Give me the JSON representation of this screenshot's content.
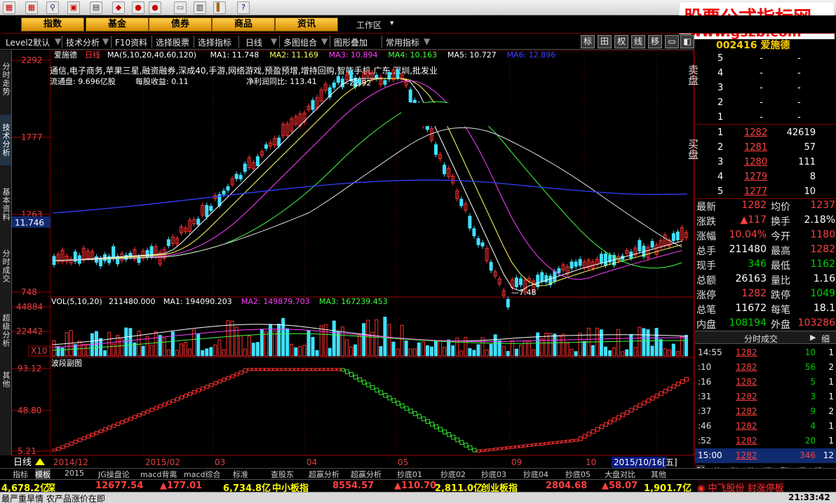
{
  "brand": {
    "line1": "股票公式指标网",
    "line2": "www.gszb.com"
  },
  "toolbar": {
    "icons": [
      "grid-icon",
      "grid-icon",
      "binoculars-icon",
      "box-icon",
      "doc-icon",
      "diamond-icon",
      "globe-icon",
      "globe-icon",
      "globe-icon",
      "doc-icon",
      "book-icon",
      "bars-icon",
      "help-icon"
    ]
  },
  "navbar": {
    "items": [
      "指数",
      "基金",
      "债券",
      "商品",
      "资讯"
    ],
    "workspace": "工作区"
  },
  "menu": {
    "items": [
      "Level2默认",
      "技术分析",
      "F10资料",
      "选择股票",
      "选择指标",
      "日线",
      "多图组合",
      "图形叠加",
      "常用指标"
    ],
    "toggles": [
      "标",
      "田",
      "权",
      "线",
      "移"
    ]
  },
  "left_tabs": [
    "分时走势",
    "技术分析",
    "基本资料",
    "分时成交",
    "超级分析",
    "其他"
  ],
  "chart": {
    "stock_name": "爱施德",
    "period": "日线",
    "ma_label": "MA(5,10,20,40,60,120)",
    "ma_values": [
      {
        "name": "MA1",
        "value": "11.748",
        "color": "#ffffff"
      },
      {
        "name": "MA2",
        "value": "11.169",
        "color": "#ffff60"
      },
      {
        "name": "MA3",
        "value": "10.894",
        "color": "#ff40ff"
      },
      {
        "name": "MA4",
        "value": "10.163",
        "color": "#40ff40"
      },
      {
        "name": "MA5",
        "value": "10.727",
        "color": "#ffffff"
      },
      {
        "name": "MA6",
        "value": "12.896",
        "color": "#4040ff"
      }
    ],
    "concepts": "通信,电子商务,苹果三星,融资融券,深成40,手游,网络游戏,预盈预增,增持回购,智能手机,广东,深圳,批发业",
    "float_shares": "流通盘: 9.696亿股",
    "eps": "每股收益: 0.11",
    "profit_growth": "净利润同比: 113.41",
    "price_ticks": [
      "2292",
      "1777",
      "1263",
      "748"
    ],
    "current_price_tag": "11.746",
    "high_label": "22.92",
    "low_label": "7.48",
    "vol_label": "VOL(5,10,20)",
    "vol_values": [
      {
        "name": "",
        "value": "211480.000",
        "color": "#ffffff"
      },
      {
        "name": "MA1",
        "value": "194090.203",
        "color": "#ffffff"
      },
      {
        "name": "MA2",
        "value": "149879.703",
        "color": "#ff40ff"
      },
      {
        "name": "MA3",
        "value": "167239.453",
        "color": "#40ff40"
      }
    ],
    "vol_ticks": [
      "44884",
      "22442"
    ],
    "vol_unit": "X10",
    "sub_title": "波段副图",
    "sub_ticks": [
      "93.12",
      "48.80",
      "5.21"
    ],
    "dates": [
      "2014/12",
      "2015/02",
      "03",
      "04",
      "05",
      "09",
      "10"
    ],
    "cursor_date": "2015/10/16[五]"
  },
  "quote": {
    "code_name": "002416 爱施德",
    "sell": [
      {
        "level": "5",
        "price": "-",
        "vol": "-"
      },
      {
        "level": "4",
        "price": "-",
        "vol": "-"
      },
      {
        "level": "3",
        "price": "-",
        "vol": "-"
      },
      {
        "level": "2",
        "price": "-",
        "vol": "-"
      },
      {
        "level": "1",
        "price": "-",
        "vol": "-"
      }
    ],
    "buy": [
      {
        "level": "1",
        "price": "1282",
        "vol": "42619"
      },
      {
        "level": "2",
        "price": "1281",
        "vol": "57"
      },
      {
        "level": "3",
        "price": "1280",
        "vol": "111"
      },
      {
        "level": "4",
        "price": "1279",
        "vol": "8"
      },
      {
        "level": "5",
        "price": "1277",
        "vol": "10"
      }
    ],
    "sell_label": "卖盘",
    "buy_label": "买盘",
    "stats": [
      {
        "l1": "最新",
        "v1": "1282",
        "l2": "均价",
        "v2": "1237",
        "c1": "#ff4040",
        "c2": "#ff4040"
      },
      {
        "l1": "涨跌",
        "v1": "▲117",
        "l2": "换手",
        "v2": "2.18%",
        "c1": "#ff4040",
        "c2": "#ffffff"
      },
      {
        "l1": "涨幅",
        "v1": "10.04%",
        "l2": "今开",
        "v2": "1180",
        "c1": "#ff4040",
        "c2": "#ff4040"
      },
      {
        "l1": "总手",
        "v1": "211480",
        "l2": "最高",
        "v2": "1282",
        "c1": "#ffffff",
        "c2": "#ff4040"
      },
      {
        "l1": "现手",
        "v1": "346",
        "l2": "最低",
        "v2": "1162",
        "c1": "#00d000",
        "c2": "#00d000"
      },
      {
        "l1": "总额",
        "v1": "26163",
        "l2": "量比",
        "v2": "1.16",
        "c1": "#ffffff",
        "c2": "#ffffff"
      },
      {
        "l1": "涨停",
        "v1": "1282",
        "l2": "跌停",
        "v2": "1049",
        "c1": "#ff4040",
        "c2": "#00d000"
      },
      {
        "l1": "总笔",
        "v1": "11672",
        "l2": "每笔",
        "v2": "18.1",
        "c1": "#ffffff",
        "c2": "#ffffff"
      },
      {
        "l1": "内盘",
        "v1": "108194",
        "l2": "外盘",
        "v2": "103286",
        "c1": "#00d000",
        "c2": "#ff4040"
      }
    ],
    "ticks_title": "分时成交",
    "ticks_detail": "细",
    "ticks": [
      {
        "time": "14:55",
        "price": "1282",
        "vol": "10",
        "n": "1"
      },
      {
        "time": ":10",
        "price": "1282",
        "vol": "56",
        "n": "2"
      },
      {
        "time": ":16",
        "price": "1282",
        "vol": "5",
        "n": "1"
      },
      {
        "time": ":31",
        "price": "1282",
        "vol": "3",
        "n": "1"
      },
      {
        "time": ":37",
        "price": "1282",
        "vol": "9",
        "n": "2"
      },
      {
        "time": ":46",
        "price": "1282",
        "vol": "4",
        "n": "1"
      },
      {
        "time": ":52",
        "price": "1282",
        "vol": "20",
        "n": "1"
      },
      {
        "time": "15:00",
        "price": "1282",
        "vol": "346",
        "n": "12"
      }
    ],
    "bottom_tabs": [
      "财",
      "价",
      "指",
      "势",
      "讯",
      "联",
      "评",
      "搜"
    ]
  },
  "bottom_tabs": [
    "指标",
    "模板",
    "2015",
    "JG操盘论",
    "macd背离",
    "macd综合",
    "标准",
    "查股东",
    "超赢分析",
    "超赢分析",
    "抄底01",
    "抄底02",
    "抄底03",
    "抄底04",
    "抄底05",
    "大盘对比",
    "其他"
  ],
  "period_label": "日线",
  "indices": [
    {
      "name": "深",
      "value": "4,678.2亿",
      "color": "#ffff00"
    },
    {
      "name": "",
      "value": "12677.54",
      "color": "#ff4040"
    },
    {
      "name": "",
      "value": "▲177.01",
      "color": "#ff4040"
    },
    {
      "name": "中小板指",
      "value": "6,734.8亿",
      "color": "#ffff00"
    },
    {
      "name": "",
      "value": "8554.57",
      "color": "#ff4040"
    },
    {
      "name": "",
      "value": "▲110.70",
      "color": "#ff4040"
    },
    {
      "name": "创业板指",
      "value": "2,811.0亿",
      "color": "#ffff00"
    },
    {
      "name": "",
      "value": "2804.68",
      "color": "#ff4040"
    },
    {
      "name": "",
      "value": "▲58.07",
      "color": "#ff4040"
    },
    {
      "name": "",
      "value": "1,901.7亿",
      "color": "#ffff00"
    }
  ],
  "ticker_alert": "中飞股份 封涨停板",
  "status": {
    "left": "最严重旱情 农产品涨价在即",
    "time": "21:33:42"
  }
}
